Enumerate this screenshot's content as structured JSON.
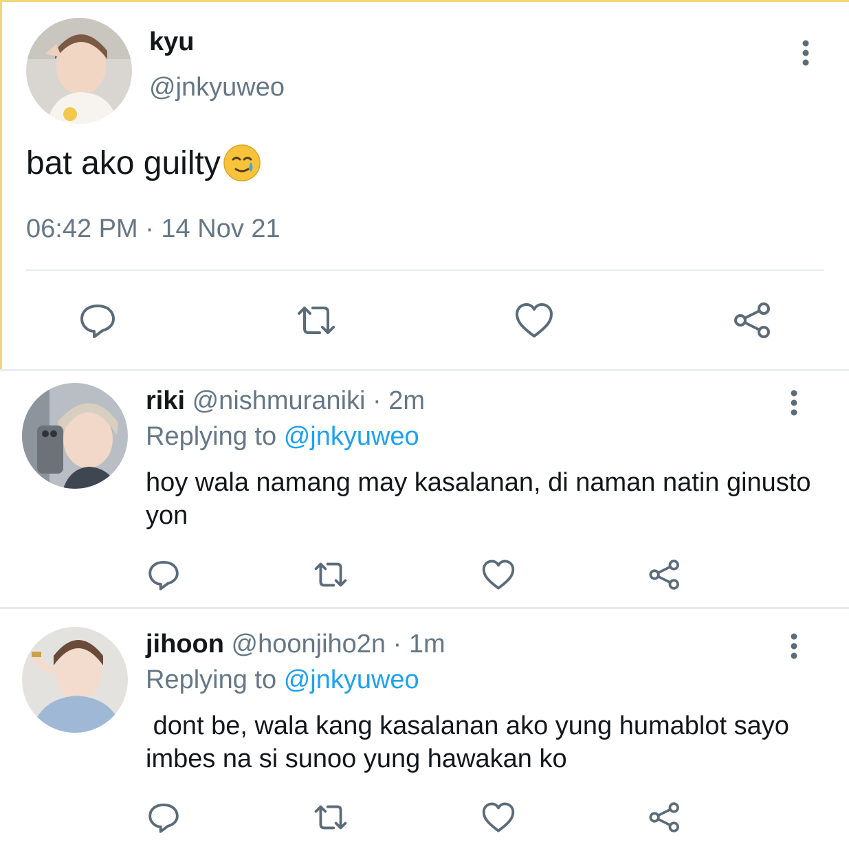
{
  "colors": {
    "accent": "#1da1f2",
    "muted": "#657786",
    "icon": "#5b6b79",
    "frame": "#f3d77a"
  },
  "tweet": {
    "display_name": "kyu",
    "handle": "@jnkyuweo",
    "text": "bat ako guilty",
    "emoji": "face-holding-back-tears",
    "timestamp": "06:42 PM · 14 Nov 21",
    "actions": [
      "reply-icon",
      "retweet-icon",
      "like-icon",
      "share-icon"
    ]
  },
  "replies": [
    {
      "display_name": "riki",
      "meta": "@nishmuraniki · 2m",
      "replying_prefix": "Replying to",
      "replying_to": "@jnkyuweo",
      "text": "hoy wala namang may kasalanan, di naman natin ginusto yon"
    },
    {
      "display_name": "jihoon",
      "meta": "@hoonjiho2n · 1m",
      "replying_prefix": "Replying to",
      "replying_to": "@jnkyuweo",
      "text": " dont be, wala kang kasalanan ako yung humablot sayo imbes na si sunoo yung hawakan ko"
    }
  ]
}
